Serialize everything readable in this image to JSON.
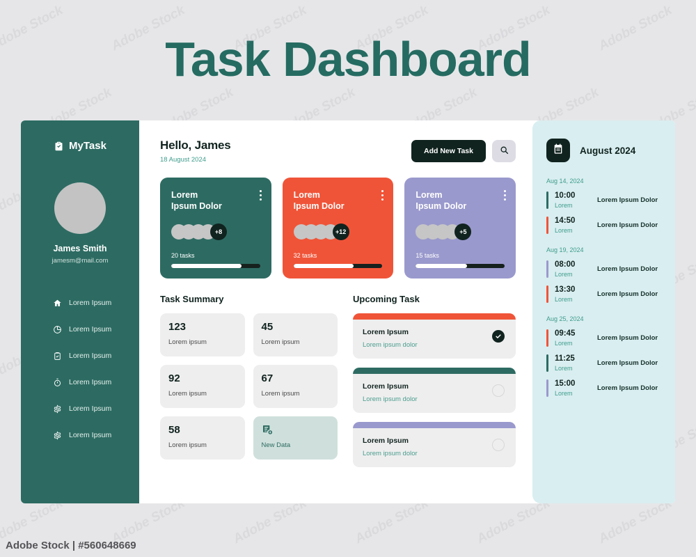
{
  "page": {
    "title": "Task Dashboard",
    "background": "#e6e6e8",
    "accent_teal": "#2d6b62",
    "accent_orange": "#f05438",
    "accent_purple": "#9a99cd",
    "accent_dark": "#10231f"
  },
  "watermark": {
    "id": "Adobe Stock | #560648669",
    "bottom": "Adobe Stock | #560648669",
    "tile": "Adobe Stock"
  },
  "sidebar": {
    "brand": "MyTask",
    "brand_icon": "clipboard-check-icon",
    "profile": {
      "name": "James Smith",
      "email": "jamesm@mail.com",
      "avatar_icon": "avatar-placeholder"
    },
    "items": [
      {
        "label": "Lorem Ipsum",
        "icon": "home-icon"
      },
      {
        "label": "Lorem Ipsum",
        "icon": "pie-chart-icon"
      },
      {
        "label": "Lorem Ipsum",
        "icon": "clipboard-check-icon"
      },
      {
        "label": "Lorem Ipsum",
        "icon": "stopwatch-icon"
      },
      {
        "label": "Lorem Ipsum",
        "icon": "gear-icon"
      },
      {
        "label": "Lorem Ipsum",
        "icon": "gear-icon"
      }
    ]
  },
  "header": {
    "greeting": "Hello, James",
    "date": "18 August 2024",
    "add_task_label": "Add New Task",
    "search_icon": "search-icon"
  },
  "project_cards": [
    {
      "title": "Lorem\nIpsum Dolor",
      "title_line1": "Lorem",
      "title_line2": "Ipsum Dolor",
      "extra_members": "+8",
      "avatars": 4,
      "tasks": "20 tasks",
      "progress": 79,
      "color": "#2d6b62"
    },
    {
      "title_line1": "Lorem",
      "title_line2": "Ipsum Dolor",
      "extra_members": "+12",
      "avatars": 4,
      "tasks": "32 tasks",
      "progress": 68,
      "color": "#f05438"
    },
    {
      "title_line1": "Lorem",
      "title_line2": "Ipsum Dolor",
      "extra_members": "+5",
      "avatars": 4,
      "tasks": "15 tasks",
      "progress": 58,
      "color": "#9a99cd"
    }
  ],
  "task_summary": {
    "title": "Task Summary",
    "cards": [
      {
        "number": "123",
        "label": "Lorem ipsum"
      },
      {
        "number": "45",
        "label": "Lorem ipsum"
      },
      {
        "number": "92",
        "label": "Lorem ipsum"
      },
      {
        "number": "67",
        "label": "Lorem ipsum"
      },
      {
        "number": "58",
        "label": "Lorem ipsum"
      }
    ],
    "new_data": {
      "label": "New Data",
      "icon": "document-plus-icon"
    }
  },
  "upcoming": {
    "title": "Upcoming Task",
    "items": [
      {
        "title": "Lorem Ipsum",
        "subtitle": "Lorem ipsum dolor",
        "color": "#f05438",
        "done": true
      },
      {
        "title": "Lorem Ipsum",
        "subtitle": "Lorem ipsum dolor",
        "color": "#2d6b62",
        "done": false
      },
      {
        "title": "Lorem Ipsum",
        "subtitle": "Lorem ipsum dolor",
        "color": "#9a99cd",
        "done": false
      }
    ]
  },
  "calendar": {
    "month": "August 2024",
    "icon": "calendar-icon",
    "groups": [
      {
        "date": "Aug 14, 2024",
        "events": [
          {
            "time": "10:00",
            "sub": "Lorem",
            "desc": "Lorem Ipsum Dolor",
            "color": "#2d6b62"
          },
          {
            "time": "14:50",
            "sub": "Lorem",
            "desc": "Lorem Ipsum Dolor",
            "color": "#f05438"
          }
        ]
      },
      {
        "date": "Aug 19, 2024",
        "events": [
          {
            "time": "08:00",
            "sub": "Lorem",
            "desc": "Lorem Ipsum Dolor",
            "color": "#9a99cd"
          },
          {
            "time": "13:30",
            "sub": "Lorem",
            "desc": "Lorem Ipsum Dolor",
            "color": "#f05438"
          }
        ]
      },
      {
        "date": "Aug 25, 2024",
        "events": [
          {
            "time": "09:45",
            "sub": "Lorem",
            "desc": "Lorem Ipsum Dolor",
            "color": "#f05438"
          },
          {
            "time": "11:25",
            "sub": "Lorem",
            "desc": "Lorem Ipsum Dolor",
            "color": "#2d6b62"
          },
          {
            "time": "15:00",
            "sub": "Lorem",
            "desc": "Lorem Ipsum Dolor",
            "color": "#9a99cd"
          }
        ]
      }
    ]
  }
}
